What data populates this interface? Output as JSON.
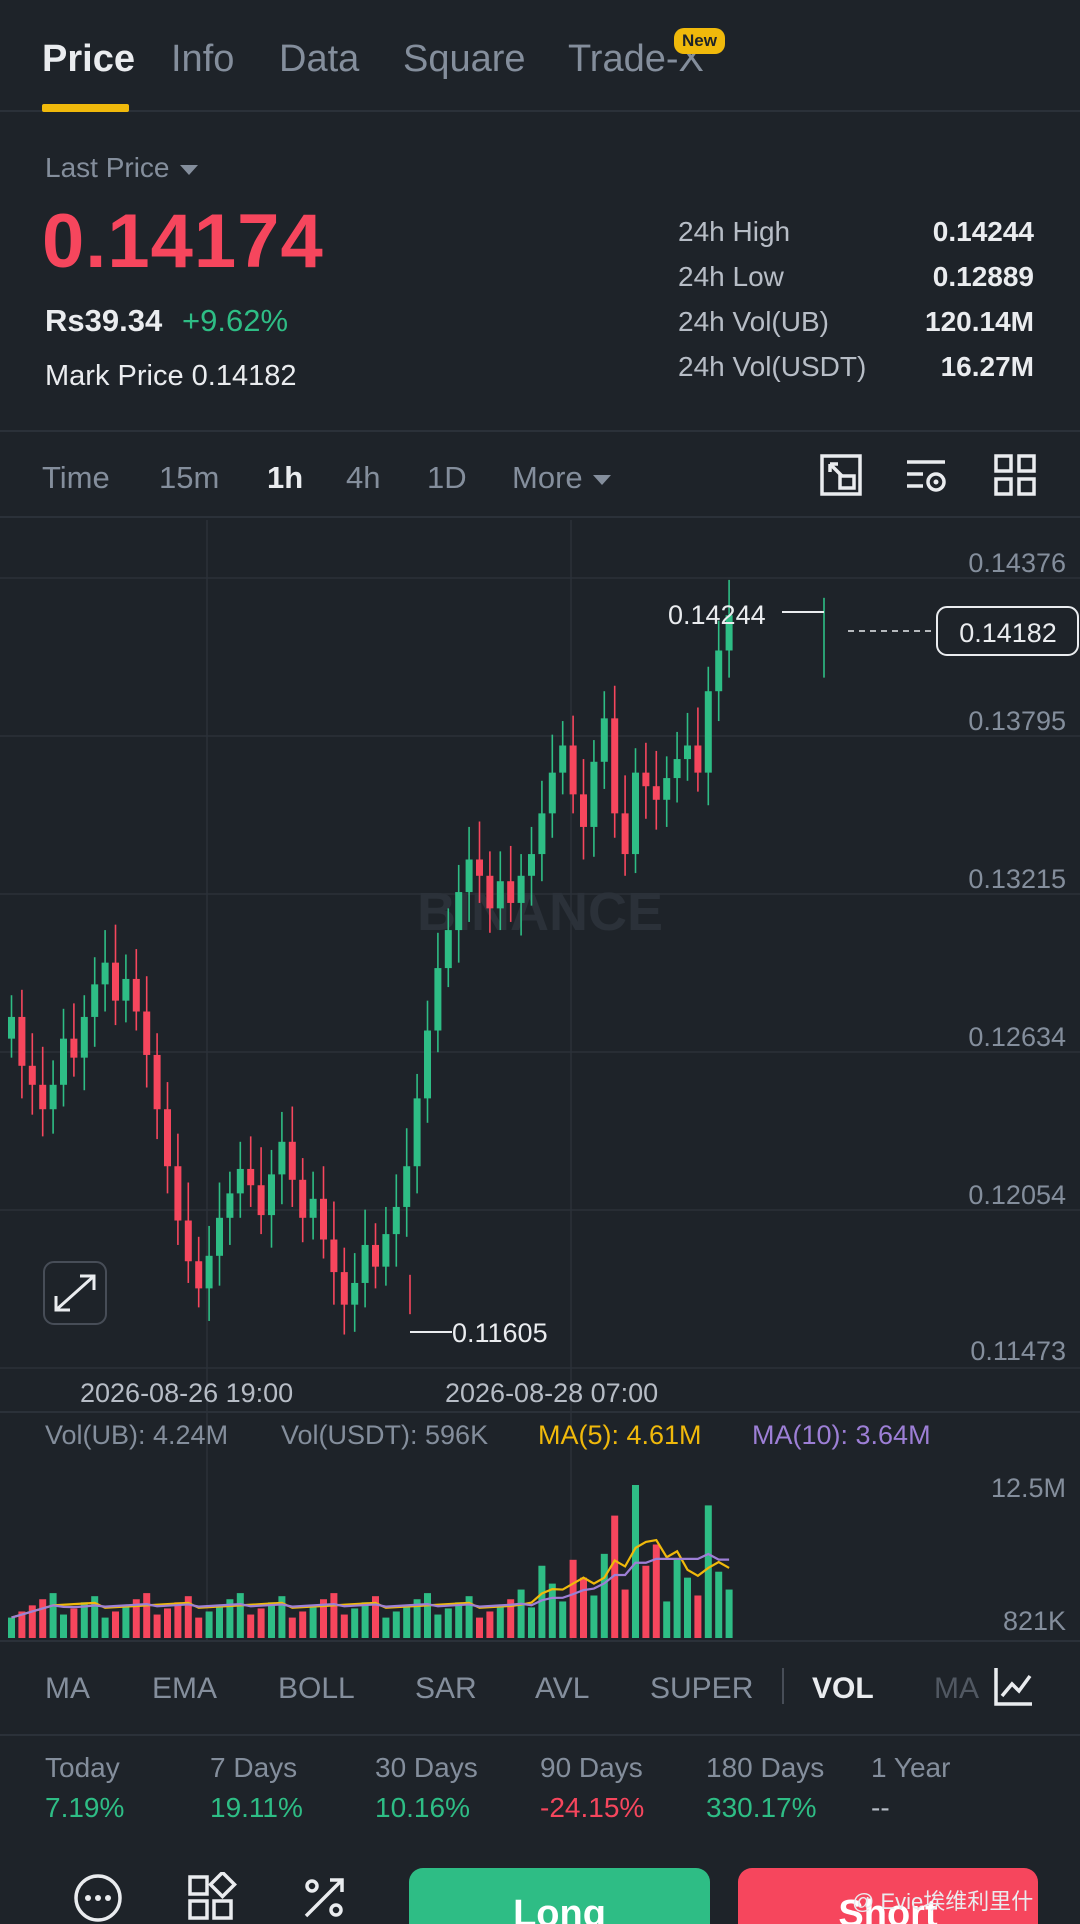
{
  "tabs": [
    {
      "label": "Price",
      "active": true
    },
    {
      "label": "Info"
    },
    {
      "label": "Data"
    },
    {
      "label": "Square"
    },
    {
      "label": "Trade-X",
      "badge": "New"
    }
  ],
  "header": {
    "last_price_label": "Last Price",
    "last_price": "0.14174",
    "rs_price": "Rs39.34",
    "change": "+9.62%",
    "mark_price_label": "Mark Price",
    "mark_price": "0.14182",
    "stats": [
      {
        "label": "24h High",
        "value": "0.14244"
      },
      {
        "label": "24h Low",
        "value": "0.12889"
      },
      {
        "label": "24h Vol(UB)",
        "value": "120.14M"
      },
      {
        "label": "24h Vol(USDT)",
        "value": "16.27M"
      }
    ]
  },
  "timeframes": [
    "Time",
    "15m",
    "1h",
    "4h",
    "1D",
    "More"
  ],
  "active_timeframe": "1h",
  "tool_icons": [
    "crop-icon",
    "settings-list-icon",
    "grid-icon"
  ],
  "chart": {
    "watermark": "BINANCE",
    "price_axis": [
      "0.14376",
      "0.13795",
      "0.13215",
      "0.12634",
      "0.12054",
      "0.11473"
    ],
    "current_price_tag": "0.14182",
    "high_marker": "0.14244",
    "low_marker": "0.11605",
    "time_labels": [
      "2026-08-26 19:00",
      "2026-08-28 07:00"
    ]
  },
  "volume": {
    "vol_ub": "Vol(UB): 4.24M",
    "vol_usdt": "Vol(USDT): 596K",
    "ma5": "MA(5): 4.61M",
    "ma10": "MA(10): 3.64M",
    "axis_top": "12.5M",
    "axis_bottom": "821K",
    "colors": {
      "ma5": "#f0b90b",
      "ma10": "#9d7fd6",
      "up": "#2ebd85",
      "down": "#f6465d"
    }
  },
  "indicators": [
    "MA",
    "EMA",
    "BOLL",
    "SAR",
    "AVL",
    "SUPER",
    "VOL",
    "MA"
  ],
  "active_indicator": "VOL",
  "performance": [
    {
      "label": "Today",
      "value": "7.19%",
      "dir": "up"
    },
    {
      "label": "7 Days",
      "value": "19.11%",
      "dir": "up"
    },
    {
      "label": "30 Days",
      "value": "10.16%",
      "dir": "up"
    },
    {
      "label": "90 Days",
      "value": "-24.15%",
      "dir": "down"
    },
    {
      "label": "180 Days",
      "value": "330.17%",
      "dir": "up"
    },
    {
      "label": "1 Year",
      "value": "--",
      "dir": "none"
    }
  ],
  "actions": {
    "long": "Long",
    "short": "Short",
    "credit": "@ Evie埃维利里什"
  }
}
